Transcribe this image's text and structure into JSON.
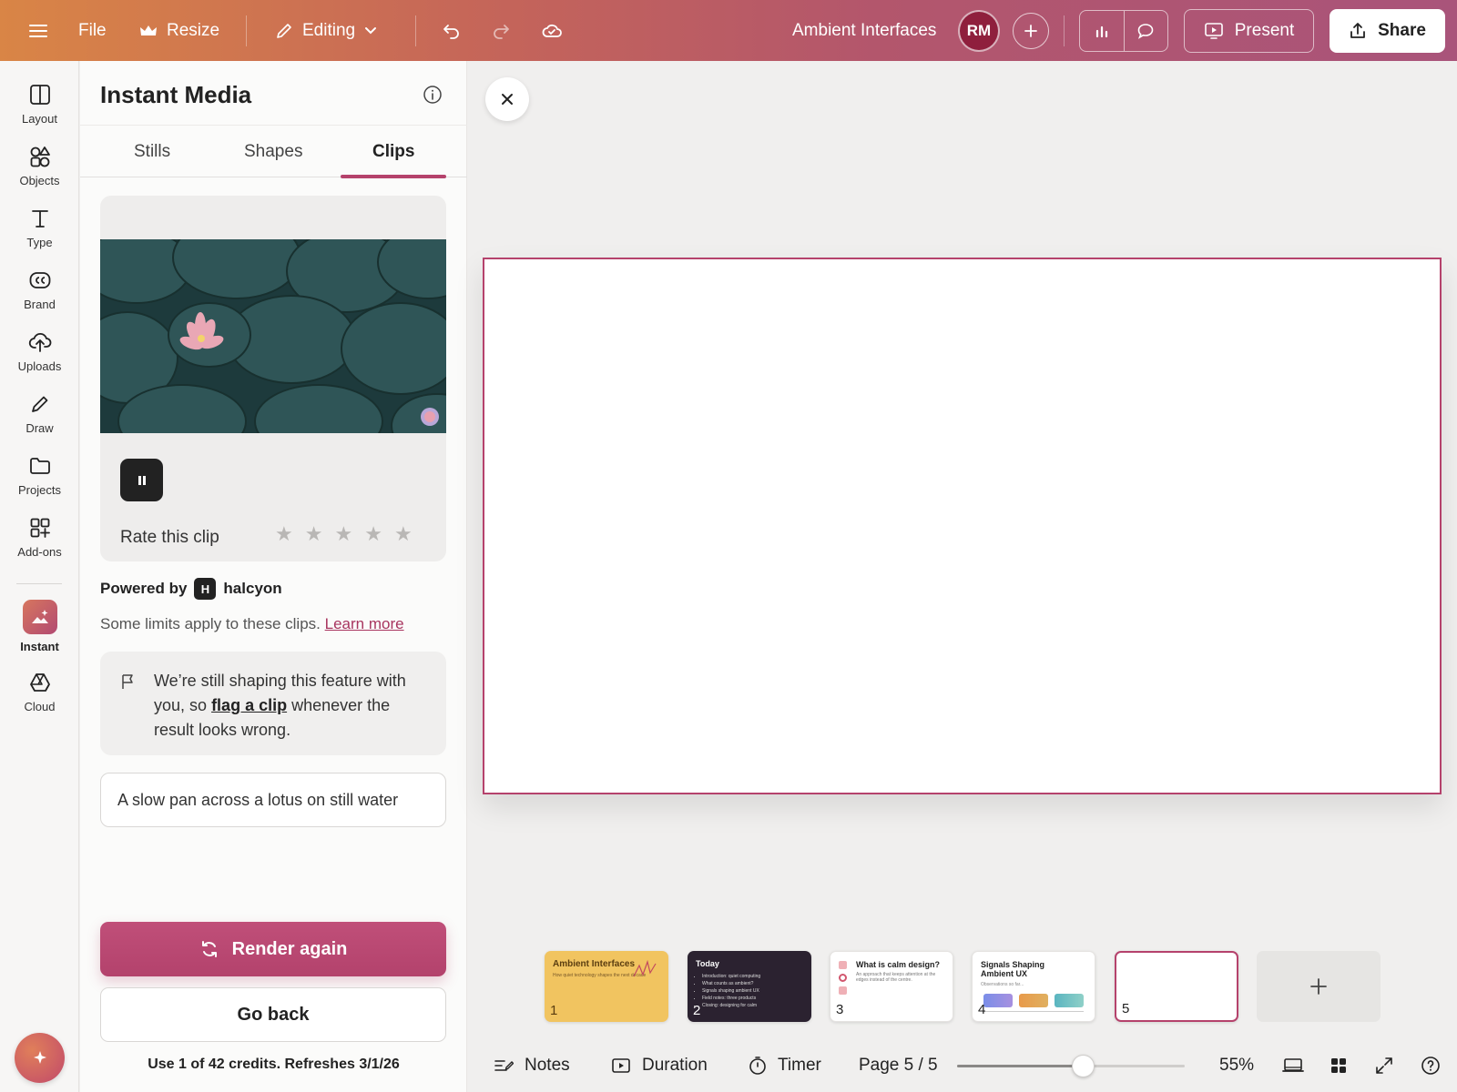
{
  "topbar": {
    "file_label": "File",
    "resize_label": "Resize",
    "mode_label": "Editing",
    "doc_title": "Ambient Interfaces",
    "user_initials": "RM",
    "present_label": "Present",
    "share_label": "Share"
  },
  "rail": {
    "items": [
      {
        "label": "Layout",
        "icon": "layout-icon"
      },
      {
        "label": "Objects",
        "icon": "objects-icon"
      },
      {
        "label": "Type",
        "icon": "type-icon"
      },
      {
        "label": "Brand",
        "icon": "brand-icon"
      },
      {
        "label": "Uploads",
        "icon": "upload-icon"
      },
      {
        "label": "Draw",
        "icon": "pencil-icon"
      },
      {
        "label": "Projects",
        "icon": "folder-icon"
      },
      {
        "label": "Add-ons",
        "icon": "addons-icon"
      },
      {
        "label": "Instant",
        "icon": "instant-icon"
      },
      {
        "label": "Cloud",
        "icon": "cloud-drive-icon"
      }
    ]
  },
  "panel": {
    "title": "Instant Media",
    "tabs": [
      "Stills",
      "Shapes",
      "Clips"
    ],
    "active_tab": "Clips",
    "rate_label": "Rate this clip",
    "rating": 0,
    "powered_by_label": "Powered by",
    "brand_letter": "H",
    "brand_name": "halcyon",
    "limits_text": "Some limits apply to these clips.",
    "learn_more": "Learn more",
    "notice_before": "We’re still shaping this feature with you, so",
    "notice_link": "flag a clip",
    "notice_after": "whenever the result looks wrong.",
    "prompt_value": "A slow pan across a lotus on still water",
    "render_label": "Render again",
    "go_back_label": "Go back",
    "credits_text": "Use 1 of 42 credits. Refreshes 3/1/26"
  },
  "thumbnails": [
    {
      "number": "1",
      "title": "Ambient Interfaces",
      "subtitle": "How quiet technology shapes the next decade"
    },
    {
      "number": "2",
      "title": "Today",
      "bullets": [
        "Introduction: quiet computing",
        "What counts as ambient?",
        "Signals shaping ambient UX",
        "Field notes: three products",
        "Closing: designing for calm"
      ]
    },
    {
      "number": "3",
      "title": "What is calm design?",
      "subtitle": "An approach that keeps attention at the edges instead of the centre."
    },
    {
      "number": "4",
      "title": "Signals Shaping Ambient UX",
      "subtitle": "Observations so far..."
    },
    {
      "number": "5"
    }
  ],
  "bottombar": {
    "notes_label": "Notes",
    "duration_label": "Duration",
    "timer_label": "Timer",
    "page_label": "Page 5 / 5",
    "zoom_percent": 55,
    "zoom_label": "55%"
  },
  "colors": {
    "accent": "#b5426c",
    "topbar_start": "#d98546",
    "topbar_end": "#a9547a"
  }
}
